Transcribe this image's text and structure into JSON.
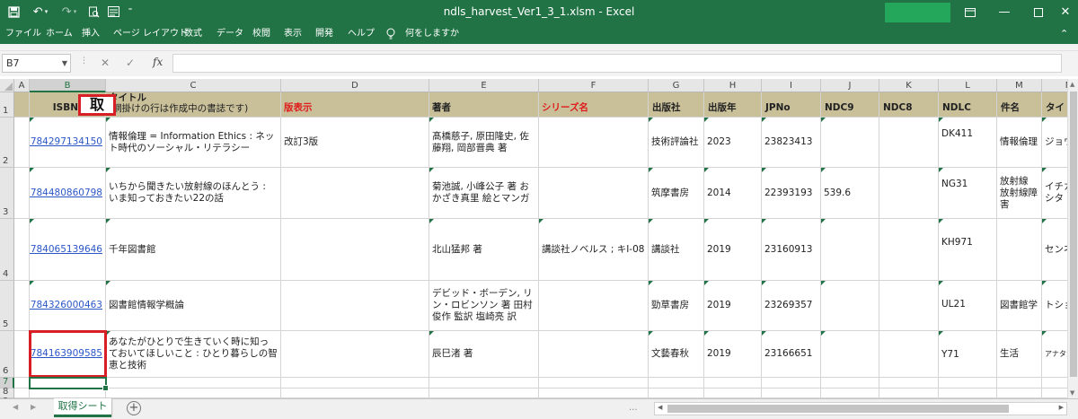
{
  "window": {
    "title": "ndls_harvest_Ver1_3_1.xlsm  -  Excel",
    "accent": "#217346"
  },
  "quick_access": {
    "save_icon": "save-icon",
    "undo_icon": "undo-icon",
    "redo_icon": "redo-icon",
    "print_preview_icon": "print-preview-icon",
    "form_icon": "form-icon",
    "customize_icon": "customize-icon"
  },
  "ribbon_tabs": [
    "ファイル",
    "ホーム",
    "挿入",
    "ページ レイアウト",
    "数式",
    "データ",
    "校閲",
    "表示",
    "開発",
    "ヘルプ"
  ],
  "tell_me": "何をしますか",
  "formula_bar": {
    "name_box": "B7",
    "formula": ""
  },
  "columns": [
    "A",
    "B",
    "C",
    "D",
    "E",
    "F",
    "G",
    "H",
    "I",
    "J",
    "K",
    "L",
    "M",
    "N"
  ],
  "rows": [
    "1",
    "2",
    "3",
    "4",
    "5",
    "6",
    "7",
    "8",
    "9",
    "10"
  ],
  "header_row": {
    "isbn": "ISBN",
    "title": "タイトル",
    "title_note": "(網掛けの行は作成中の書誌です)",
    "edition": "版表示",
    "author": "著者",
    "series": "シリーズ名",
    "publisher": "出版社",
    "year": "出版年",
    "jpno": "JPNo",
    "ndc9": "NDC9",
    "ndc8": "NDC8",
    "ndlc": "NDLC",
    "subject": "件名",
    "title_yomi": "タイトルヨミ",
    "header_color": "#c9c09a",
    "red_header_color": "#e01c1c"
  },
  "popup_label": "取",
  "records": [
    {
      "isbn": "9784297134150",
      "title": "情報倫理 = Information Ethics : ネット時代のソーシャル・リテラシー",
      "edition": "改訂3版",
      "author": "髙橋慈子, 原田隆史, 佐藤翔, 岡部晋典 著",
      "series": "",
      "publisher": "技術評論社",
      "year": "2023",
      "jpno": "23823413",
      "ndc9": "",
      "ndc8": "",
      "ndlc": "DK411",
      "subject": "情報倫理",
      "title_yomi": "ジョウ"
    },
    {
      "isbn": "9784480860798",
      "title": "いちから聞きたい放射線のほんとう : いま知っておきたい22の話",
      "edition": "",
      "author": "菊池誠, 小峰公子 著 おかざき真里 絵とマンガ",
      "series": "",
      "publisher": "筑摩書房",
      "year": "2014",
      "jpno": "22393193",
      "ndc9": "539.6",
      "ndc8": "",
      "ndlc": "NG31",
      "subject": "放射線 放射線障害",
      "title_yomi": "イチカ マシタ"
    },
    {
      "isbn": "9784065139646",
      "title": "千年図書館",
      "edition": "",
      "author": "北山猛邦 著",
      "series": "講談社ノベルス ; キI-08",
      "publisher": "講談社",
      "year": "2019",
      "jpno": "23160913",
      "ndc9": "",
      "ndc8": "",
      "ndlc": "KH971",
      "subject": "",
      "title_yomi": "センネ"
    },
    {
      "isbn": "9784326000463",
      "title": "図書館情報学概論",
      "edition": "",
      "author": "デビッド・ボーデン, リン・ロビンソン 著 田村俊作 監訳 塩崎亮 訳",
      "series": "",
      "publisher": "勁草書房",
      "year": "2019",
      "jpno": "23269357",
      "ndc9": "",
      "ndc8": "",
      "ndlc": "UL21",
      "subject": "図書館学",
      "title_yomi": "トショ"
    },
    {
      "isbn": "9784163909585",
      "title": "あなたがひとりで生きていく時に知っておいてほしいこと : ひとり暮らしの智恵と技術",
      "edition": "",
      "author": "辰巳渚 著",
      "series": "",
      "publisher": "文藝春秋",
      "year": "2019",
      "jpno": "23166651",
      "ndc9": "",
      "ndc8": "",
      "ndlc": "Y71",
      "subject": "生活",
      "title_yomi": "アナタガヒ"
    }
  ],
  "sheet_tabs": [
    "取得シート"
  ],
  "add_sheet": "+",
  "more": "..."
}
